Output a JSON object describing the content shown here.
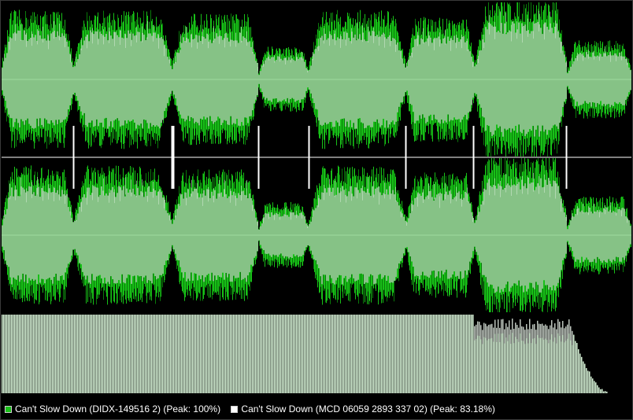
{
  "colors": {
    "background": "#000000",
    "track_a": "#18c018",
    "track_a_dark": "#0a7a0a",
    "track_b": "#ffffff",
    "overlap_fill": "#86c286",
    "center_line": "#9fd99f",
    "divider": "#808080",
    "histogram": "#d9f5d9",
    "track_marker": "#ffffff"
  },
  "legend": {
    "track_a": {
      "label": "Can't Slow Down (DIDX-149516 2) (Peak: 100%)",
      "swatch_color": "#18c018"
    },
    "track_b": {
      "label": "Can't Slow Down (MCD 06059 2893 337 02) (Peak: 83.18%)",
      "swatch_color": "#ffffff"
    }
  },
  "tracks": [
    {
      "level": 0.8
    },
    {
      "level": 0.8
    },
    {
      "level": 0.76
    },
    {
      "level": 0.38
    },
    {
      "level": 0.8
    },
    {
      "level": 0.72
    },
    {
      "level": 0.94
    },
    {
      "level": 0.45
    }
  ]
}
